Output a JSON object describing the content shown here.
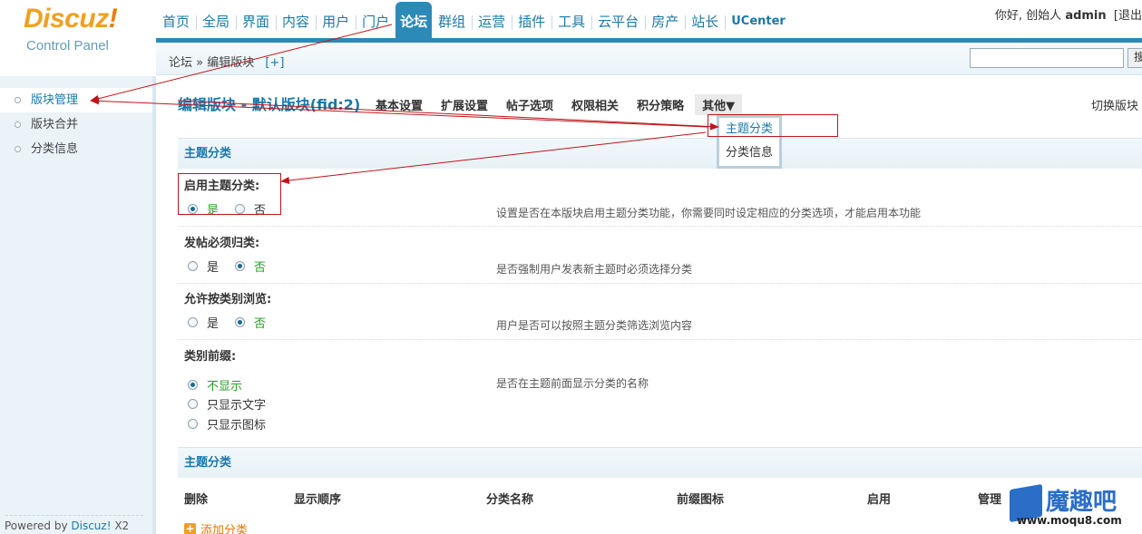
{
  "logo": {
    "main": "Discuz",
    "bang": "!",
    "sub": "Control Panel"
  },
  "nav": {
    "items": [
      "首页",
      "全局",
      "界面",
      "内容",
      "用户",
      "门户",
      "论坛",
      "群组",
      "运营",
      "插件",
      "工具",
      "云平台",
      "房产",
      "站长",
      "UCenter"
    ],
    "active_index": 6
  },
  "user": {
    "greeting": "你好, 创始人",
    "name": "admin",
    "logout": "[退出"
  },
  "breadcrumb": {
    "path": "论坛 » 编辑版块",
    "add": "[+]"
  },
  "search": {
    "value": "",
    "button": "搜"
  },
  "sidebar": {
    "items": [
      {
        "label": "版块管理",
        "active": true
      },
      {
        "label": "版块合并",
        "active": false
      },
      {
        "label": "分类信息",
        "active": false
      }
    ],
    "powered_prefix": "Powered by ",
    "powered_brand": "Discuz!",
    "powered_version": " X2"
  },
  "page": {
    "title": "编辑版块 - 默认版块(fid:2)",
    "tabs": [
      "基本设置",
      "扩展设置",
      "帖子选项",
      "权限相关",
      "积分策略",
      "其他▼"
    ],
    "switch": "切换版块"
  },
  "dropdown": {
    "items": [
      "主题分类",
      "分类信息"
    ]
  },
  "section1": {
    "title": "主题分类"
  },
  "settings": {
    "enable": {
      "label": "启用主题分类:",
      "yes": "是",
      "no": "否",
      "selected": "yes",
      "hint": "设置是否在本版块启用主题分类功能，你需要同时设定相应的分类选项，才能启用本功能"
    },
    "required": {
      "label": "发帖必须归类:",
      "yes": "是",
      "no": "否",
      "selected": "no",
      "hint": "是否强制用户发表新主题时必须选择分类"
    },
    "browse": {
      "label": "允许按类别浏览:",
      "yes": "是",
      "no": "否",
      "selected": "no",
      "hint": "用户是否可以按照主题分类筛选浏览内容"
    },
    "prefix": {
      "label": "类别前缀:",
      "options": [
        "不显示",
        "只显示文字",
        "只显示图标"
      ],
      "selected_index": 0,
      "hint": "是否在主题前面显示分类的名称"
    }
  },
  "section2": {
    "title": "主题分类"
  },
  "table": {
    "headers": [
      "删除",
      "显示顺序",
      "分类名称",
      "前缀图标",
      "启用",
      "管理"
    ]
  },
  "add_category": "添加分类",
  "watermark": {
    "text": "魔趣吧",
    "url": "www.moqu8.com"
  },
  "colors": {
    "accent": "#2b8ab8",
    "link": "#1a78a8",
    "annotation": "#c0141a",
    "selected_option": "#2a9a2a"
  }
}
